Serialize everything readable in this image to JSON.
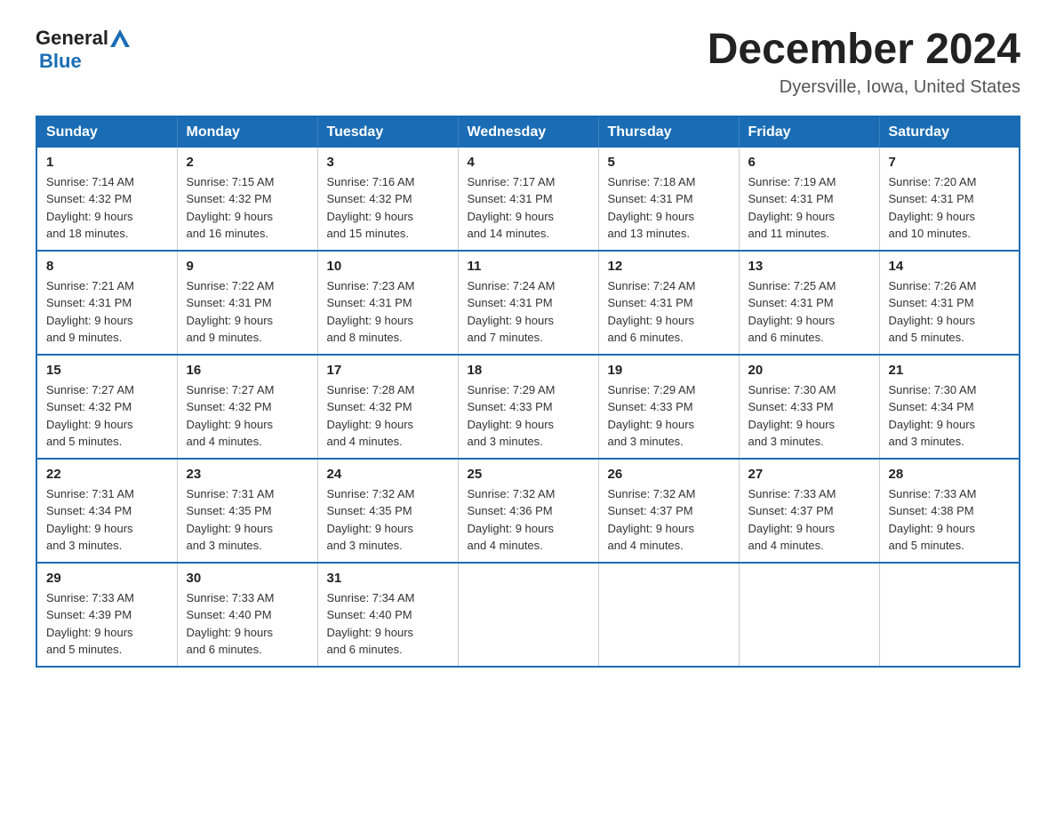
{
  "header": {
    "logo_text_general": "General",
    "logo_text_blue": "Blue",
    "month_title": "December 2024",
    "location": "Dyersville, Iowa, United States"
  },
  "weekdays": [
    "Sunday",
    "Monday",
    "Tuesday",
    "Wednesday",
    "Thursday",
    "Friday",
    "Saturday"
  ],
  "weeks": [
    [
      {
        "day": "1",
        "sunrise": "7:14 AM",
        "sunset": "4:32 PM",
        "daylight": "9 hours and 18 minutes."
      },
      {
        "day": "2",
        "sunrise": "7:15 AM",
        "sunset": "4:32 PM",
        "daylight": "9 hours and 16 minutes."
      },
      {
        "day": "3",
        "sunrise": "7:16 AM",
        "sunset": "4:32 PM",
        "daylight": "9 hours and 15 minutes."
      },
      {
        "day": "4",
        "sunrise": "7:17 AM",
        "sunset": "4:31 PM",
        "daylight": "9 hours and 14 minutes."
      },
      {
        "day": "5",
        "sunrise": "7:18 AM",
        "sunset": "4:31 PM",
        "daylight": "9 hours and 13 minutes."
      },
      {
        "day": "6",
        "sunrise": "7:19 AM",
        "sunset": "4:31 PM",
        "daylight": "9 hours and 11 minutes."
      },
      {
        "day": "7",
        "sunrise": "7:20 AM",
        "sunset": "4:31 PM",
        "daylight": "9 hours and 10 minutes."
      }
    ],
    [
      {
        "day": "8",
        "sunrise": "7:21 AM",
        "sunset": "4:31 PM",
        "daylight": "9 hours and 9 minutes."
      },
      {
        "day": "9",
        "sunrise": "7:22 AM",
        "sunset": "4:31 PM",
        "daylight": "9 hours and 9 minutes."
      },
      {
        "day": "10",
        "sunrise": "7:23 AM",
        "sunset": "4:31 PM",
        "daylight": "9 hours and 8 minutes."
      },
      {
        "day": "11",
        "sunrise": "7:24 AM",
        "sunset": "4:31 PM",
        "daylight": "9 hours and 7 minutes."
      },
      {
        "day": "12",
        "sunrise": "7:24 AM",
        "sunset": "4:31 PM",
        "daylight": "9 hours and 6 minutes."
      },
      {
        "day": "13",
        "sunrise": "7:25 AM",
        "sunset": "4:31 PM",
        "daylight": "9 hours and 6 minutes."
      },
      {
        "day": "14",
        "sunrise": "7:26 AM",
        "sunset": "4:31 PM",
        "daylight": "9 hours and 5 minutes."
      }
    ],
    [
      {
        "day": "15",
        "sunrise": "7:27 AM",
        "sunset": "4:32 PM",
        "daylight": "9 hours and 5 minutes."
      },
      {
        "day": "16",
        "sunrise": "7:27 AM",
        "sunset": "4:32 PM",
        "daylight": "9 hours and 4 minutes."
      },
      {
        "day": "17",
        "sunrise": "7:28 AM",
        "sunset": "4:32 PM",
        "daylight": "9 hours and 4 minutes."
      },
      {
        "day": "18",
        "sunrise": "7:29 AM",
        "sunset": "4:33 PM",
        "daylight": "9 hours and 3 minutes."
      },
      {
        "day": "19",
        "sunrise": "7:29 AM",
        "sunset": "4:33 PM",
        "daylight": "9 hours and 3 minutes."
      },
      {
        "day": "20",
        "sunrise": "7:30 AM",
        "sunset": "4:33 PM",
        "daylight": "9 hours and 3 minutes."
      },
      {
        "day": "21",
        "sunrise": "7:30 AM",
        "sunset": "4:34 PM",
        "daylight": "9 hours and 3 minutes."
      }
    ],
    [
      {
        "day": "22",
        "sunrise": "7:31 AM",
        "sunset": "4:34 PM",
        "daylight": "9 hours and 3 minutes."
      },
      {
        "day": "23",
        "sunrise": "7:31 AM",
        "sunset": "4:35 PM",
        "daylight": "9 hours and 3 minutes."
      },
      {
        "day": "24",
        "sunrise": "7:32 AM",
        "sunset": "4:35 PM",
        "daylight": "9 hours and 3 minutes."
      },
      {
        "day": "25",
        "sunrise": "7:32 AM",
        "sunset": "4:36 PM",
        "daylight": "9 hours and 4 minutes."
      },
      {
        "day": "26",
        "sunrise": "7:32 AM",
        "sunset": "4:37 PM",
        "daylight": "9 hours and 4 minutes."
      },
      {
        "day": "27",
        "sunrise": "7:33 AM",
        "sunset": "4:37 PM",
        "daylight": "9 hours and 4 minutes."
      },
      {
        "day": "28",
        "sunrise": "7:33 AM",
        "sunset": "4:38 PM",
        "daylight": "9 hours and 5 minutes."
      }
    ],
    [
      {
        "day": "29",
        "sunrise": "7:33 AM",
        "sunset": "4:39 PM",
        "daylight": "9 hours and 5 minutes."
      },
      {
        "day": "30",
        "sunrise": "7:33 AM",
        "sunset": "4:40 PM",
        "daylight": "9 hours and 6 minutes."
      },
      {
        "day": "31",
        "sunrise": "7:34 AM",
        "sunset": "4:40 PM",
        "daylight": "9 hours and 6 minutes."
      },
      null,
      null,
      null,
      null
    ]
  ]
}
